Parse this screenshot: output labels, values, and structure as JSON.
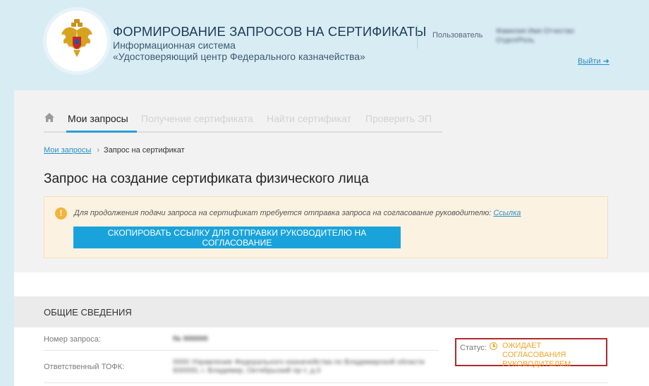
{
  "header": {
    "title": "ФОРМИРОВАНИЕ ЗАПРОСОВ НА СЕРТИФИКАТЫ",
    "subtitle_1": "Информационная система",
    "subtitle_2": "«Удостоверяющий центр Федерального казначейства»",
    "user_label": "Пользователь",
    "user_name_line_1": "Фамилия Имя Отчество",
    "user_name_line_2": "Отдел/Роль",
    "logout": "Выйти ➜",
    "emblem_icon": "coat-of-arms-icon"
  },
  "nav": {
    "items": [
      {
        "label": "Мои запросы",
        "active": true
      },
      {
        "label": "Получение сертификата",
        "active": false
      },
      {
        "label": "Найти сертификат",
        "active": false
      },
      {
        "label": "Проверить ЭП",
        "active": false
      }
    ],
    "home_icon": "home-icon"
  },
  "breadcrumb": {
    "link": "Мои запросы",
    "separator": "›",
    "current": "Запрос на сертификат"
  },
  "page_title": "Запрос на создание сертификата физического лица",
  "alert": {
    "icon": "warning-icon",
    "icon_glyph": "!",
    "text": "Для продолжения подачи запроса на сертификат требуется отправка запроса на согласование руководителю:",
    "link": "Ссылка",
    "button": "СКОПИРОВАТЬ ССЫЛКУ ДЛЯ ОТПРАВКИ РУКОВОДИТЕЛЮ НА СОГЛАСОВАНИЕ"
  },
  "section": {
    "title": "ОБЩИЕ СВЕДЕНИЯ",
    "fields": [
      {
        "label": "Номер запроса:",
        "value_line_1": "№ 000000",
        "value_line_2": ""
      },
      {
        "label": "Ответственный ТОФК:",
        "value_line_1": "0000 Управление Федерального казначейства по Владимирской области",
        "value_line_2": "600000, г. Владимир, Октябрьский пр-т, д.0"
      }
    ],
    "status": {
      "label": "Статус:",
      "icon": "clock-icon",
      "value_line_1": "ОЖИДАЕТ СОГЛАСОВАНИЯ",
      "value_line_2": "РУКОВОДИТЕЛЕМ"
    }
  },
  "colors": {
    "accent": "#2a9fd6",
    "button": "#1aa3da",
    "status": "#f0a62a",
    "highlight_border": "#b02a2e"
  }
}
